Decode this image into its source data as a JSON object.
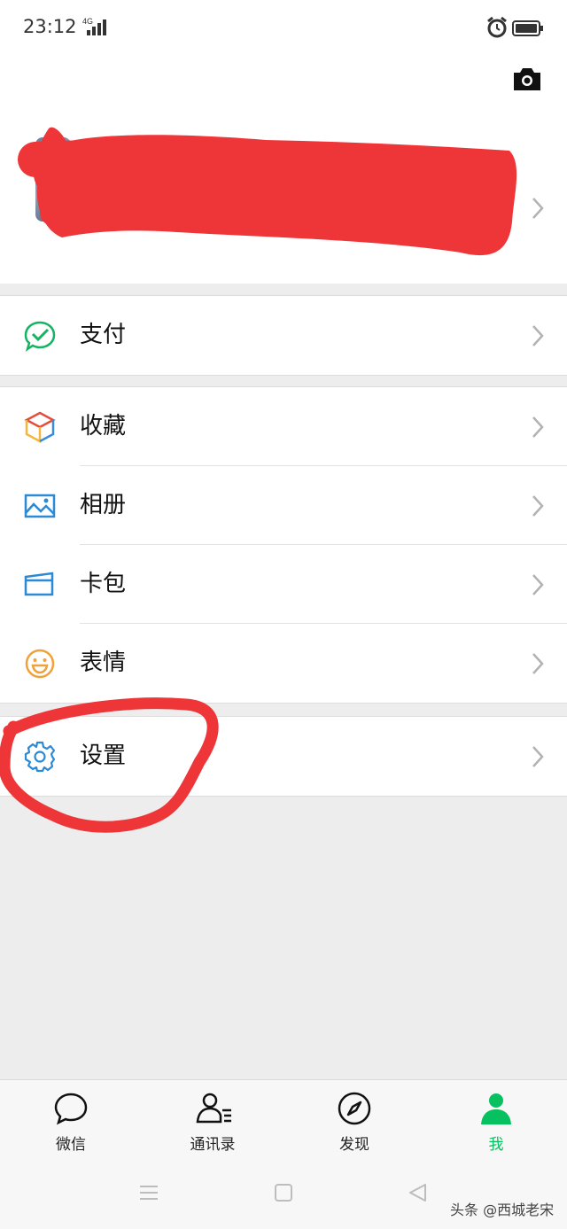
{
  "status_bar": {
    "time": "23:12",
    "network": "4G"
  },
  "menu": {
    "pay": {
      "label": "支付",
      "icon": "wechat-pay-icon"
    },
    "favorites": {
      "label": "收藏",
      "icon": "cube-icon"
    },
    "album": {
      "label": "相册",
      "icon": "image-icon"
    },
    "cards": {
      "label": "卡包",
      "icon": "wallet-icon"
    },
    "stickers": {
      "label": "表情",
      "icon": "smiley-icon"
    },
    "settings": {
      "label": "设置",
      "icon": "gear-icon"
    }
  },
  "tabbar": {
    "tabs": [
      {
        "label": "微信",
        "icon": "chat-bubble-icon"
      },
      {
        "label": "通讯录",
        "icon": "contacts-icon"
      },
      {
        "label": "发现",
        "icon": "compass-icon"
      },
      {
        "label": "我",
        "icon": "person-icon"
      }
    ],
    "active_color": "#07c160"
  },
  "watermark": "头条 @西城老宋",
  "colors": {
    "annotation_red": "#e8363a",
    "accent_green": "#07c160"
  }
}
